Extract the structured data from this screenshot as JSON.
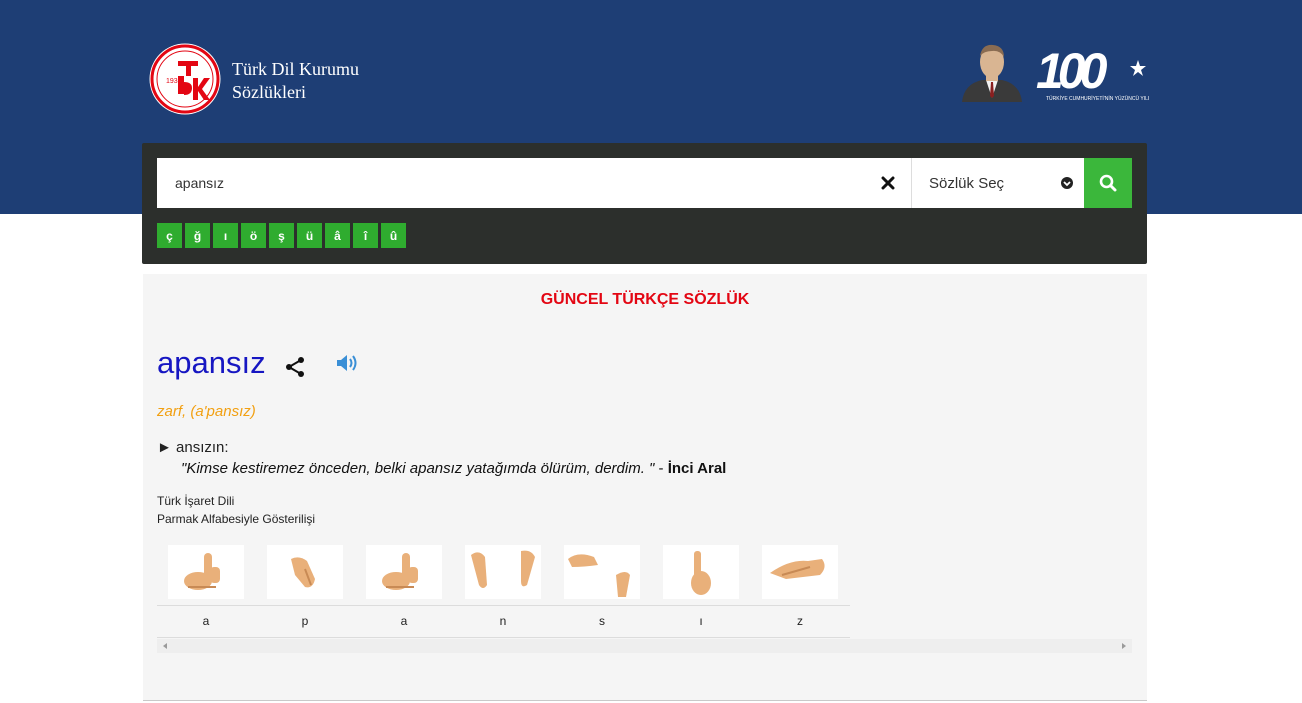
{
  "header": {
    "brand_line1": "Türk Dil Kurumu",
    "brand_line2": "Sözlükleri",
    "logo_year": "1932",
    "logo_text": "TDK",
    "centennial_number": "100",
    "centennial_caption": "TÜRKİYE CUMHURİYETİ'NİN YÜZÜNCÜ YILI"
  },
  "search": {
    "value": "apansız",
    "clear_icon": "close-icon",
    "dictionary_select_label": "Sözlük Seç",
    "search_icon": "search-icon"
  },
  "special_chars": [
    "ç",
    "ğ",
    "ı",
    "ö",
    "ş",
    "ü",
    "â",
    "î",
    "û"
  ],
  "result": {
    "dictionary_title": "GÜNCEL TÜRKÇE SÖZLÜK",
    "word": "apansız",
    "part_of_speech": "zarf, (a'pansız)",
    "meaning_marker": "►",
    "meaning": "ansızın:",
    "example": "\"Kimse kestiremez önceden, belki apansız yatağımda ölürüm, derdim. \"",
    "example_separator": " - ",
    "example_author": "İnci Aral",
    "sign_language_title": "Türk İşaret Dili",
    "sign_language_subtitle": "Parmak Alfabesiyle Gösterilişi",
    "letters": [
      "a",
      "p",
      "a",
      "n",
      "s",
      "ı",
      "z"
    ]
  },
  "colors": {
    "header_bg": "#1e3e75",
    "dictionary_title": "#e30613",
    "word": "#1616c2",
    "part_of_speech": "#f2a012",
    "button_green": "#3bb73b",
    "search_panel_bg": "#2c2f2c"
  }
}
